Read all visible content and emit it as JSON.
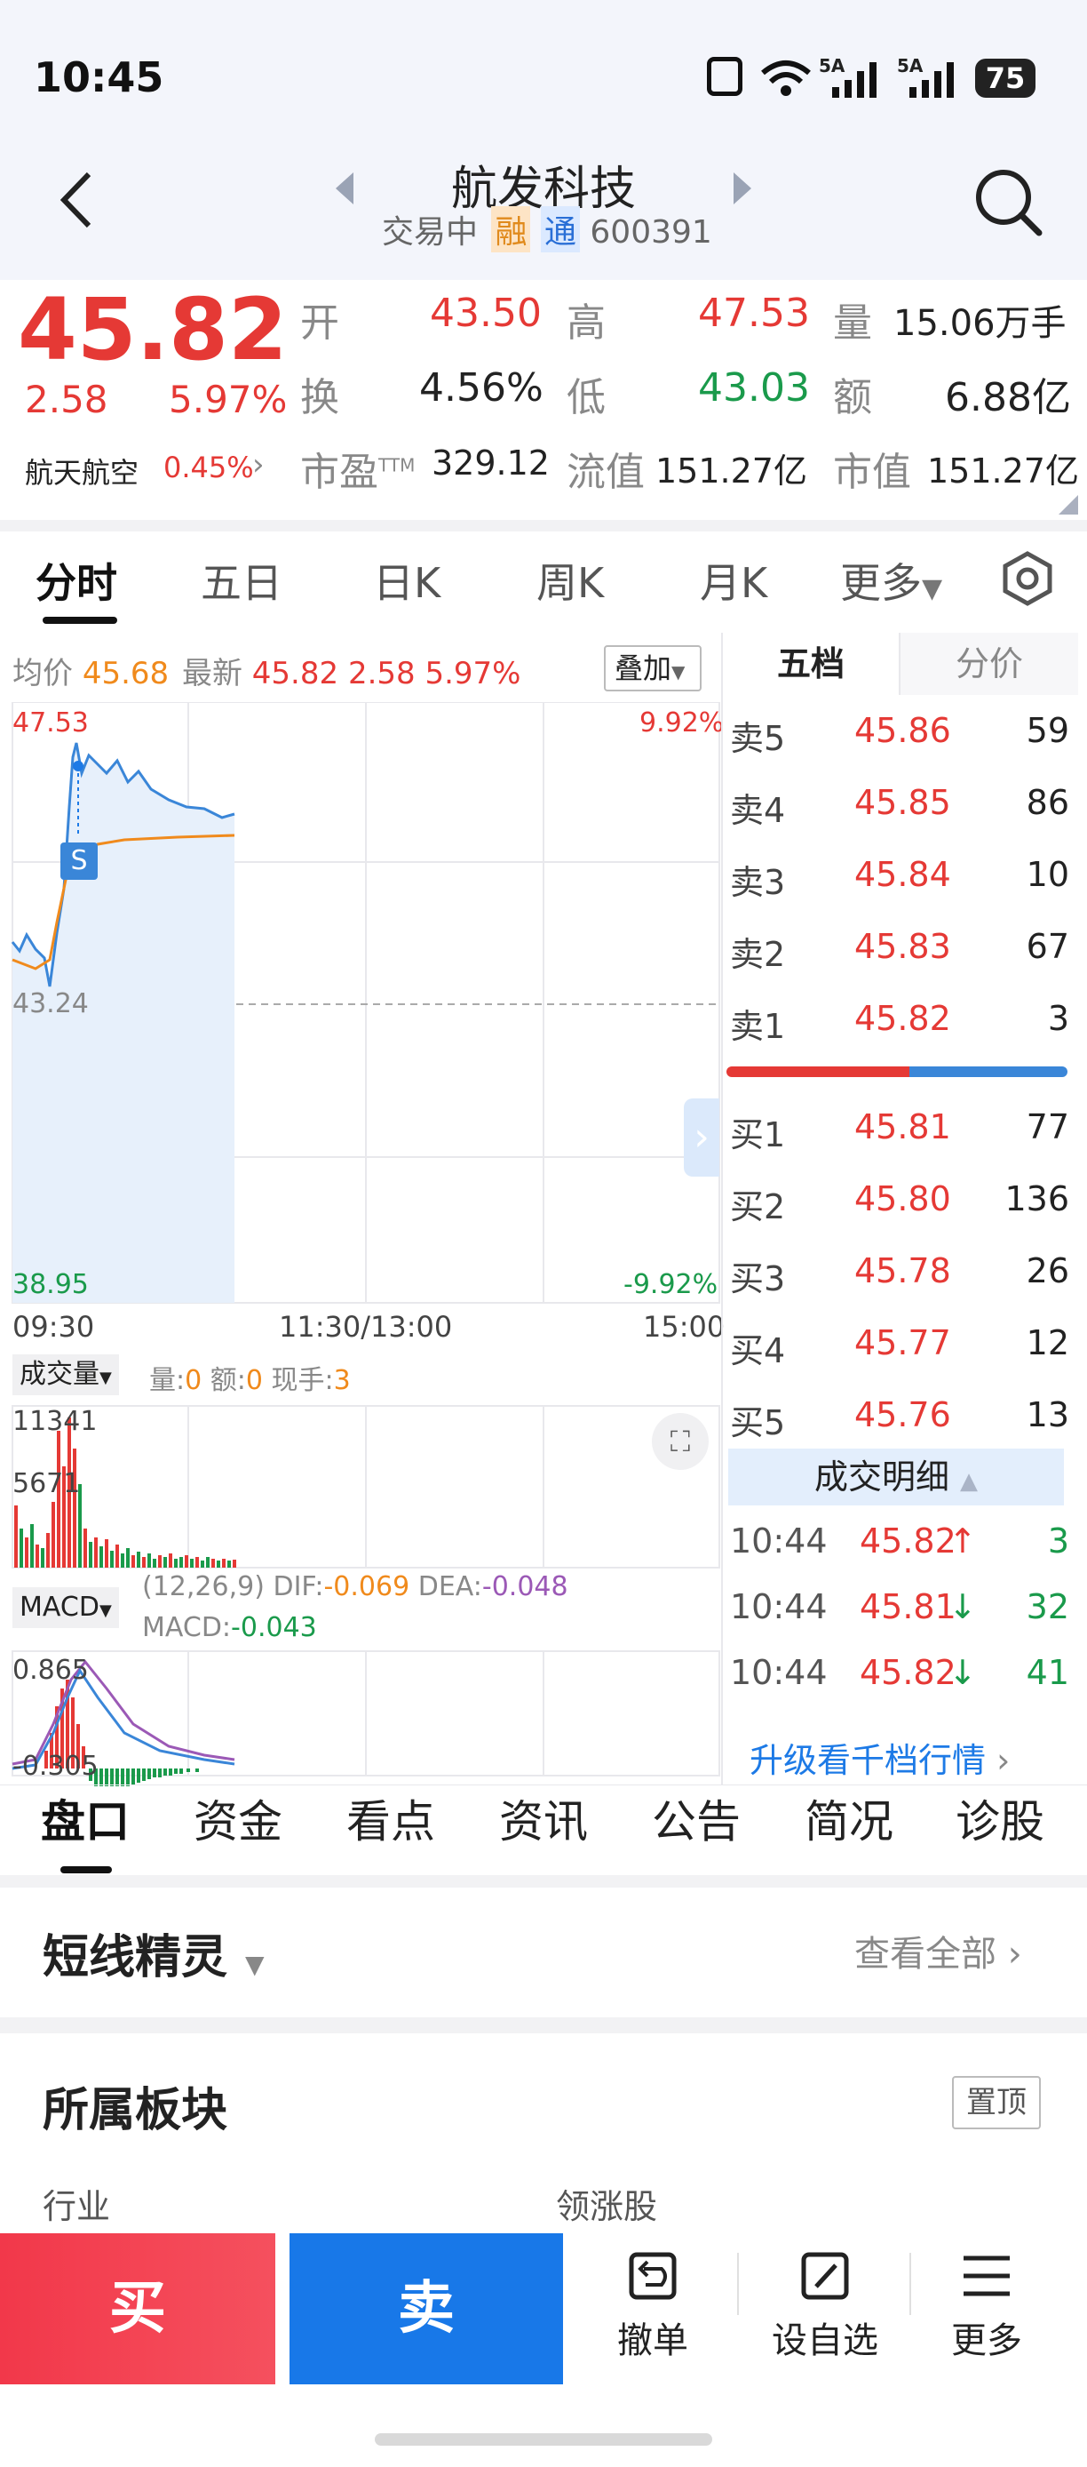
{
  "status": {
    "time": "10:45",
    "signal1": "5A",
    "signal2": "5A",
    "battery": "75"
  },
  "header": {
    "stock_name": "航发科技",
    "status": "交易中",
    "badge1": "融",
    "badge2": "通",
    "code": "600391"
  },
  "quote": {
    "price": "45.82",
    "change": "2.58",
    "change_pct": "5.97%",
    "sector": "航天航空",
    "sector_pct": "0.45%",
    "open_label": "开",
    "open": "43.50",
    "high_label": "高",
    "high": "47.53",
    "vol_label": "量",
    "vol": "15.06万手",
    "turnover_label": "换",
    "turnover": "4.56%",
    "low_label": "低",
    "low": "43.03",
    "amt_label": "额",
    "amt": "6.88亿",
    "pe_label": "市盈",
    "pe_sup": "TTM",
    "pe": "329.12",
    "float_label": "流值",
    "float_val": "151.27亿",
    "cap_label": "市值",
    "cap": "151.27亿"
  },
  "chart_tabs": [
    "分时",
    "五日",
    "日K",
    "周K",
    "月K",
    "更多"
  ],
  "intraday": {
    "avg_label": "均价",
    "avg": "45.68",
    "latest_label": "最新",
    "latest": "45.82",
    "chg": "2.58",
    "pct": "5.97%",
    "overlay": "叠加",
    "y_high": "47.53",
    "y_mid": "43.24",
    "y_low": "38.95",
    "pct_high": "9.92%",
    "pct_low": "-9.92%",
    "t_start": "09:30",
    "t_mid": "11:30/13:00",
    "t_end": "15:00",
    "marker": "S",
    "vol_label": "成交量",
    "vol_text": "量:",
    "vol_v": "0",
    "amt_text": "额:",
    "amt_v": "0",
    "hand_text": "现手:",
    "hand_v": "3",
    "vol_max": "11341",
    "vol_mid": "5671",
    "macd_label": "MACD",
    "macd_param": "(12,26,9)",
    "dif_label": "DIF:",
    "dif": "-0.069",
    "dea_label": "DEA:",
    "dea": "-0.048",
    "macd_text": "MACD:",
    "macd": "-0.043",
    "macd_max": "0.865",
    "macd_min": "-0.305"
  },
  "orderbook": {
    "tab1": "五档",
    "tab2": "分价",
    "asks": [
      {
        "label": "卖5",
        "price": "45.86",
        "vol": "59"
      },
      {
        "label": "卖4",
        "price": "45.85",
        "vol": "86"
      },
      {
        "label": "卖3",
        "price": "45.84",
        "vol": "10"
      },
      {
        "label": "卖2",
        "price": "45.83",
        "vol": "67"
      },
      {
        "label": "卖1",
        "price": "45.82",
        "vol": "3"
      }
    ],
    "bids": [
      {
        "label": "买1",
        "price": "45.81",
        "vol": "77"
      },
      {
        "label": "买2",
        "price": "45.80",
        "vol": "136"
      },
      {
        "label": "买3",
        "price": "45.78",
        "vol": "26"
      },
      {
        "label": "买4",
        "price": "45.77",
        "vol": "12"
      },
      {
        "label": "买5",
        "price": "45.76",
        "vol": "13"
      }
    ],
    "detail_label": "成交明细",
    "trades": [
      {
        "time": "10:44",
        "price": "45.82",
        "arrow": "↑",
        "vol": "3"
      },
      {
        "time": "10:44",
        "price": "45.81",
        "arrow": "↓",
        "vol": "32"
      },
      {
        "time": "10:44",
        "price": "45.82",
        "arrow": "↓",
        "vol": "41"
      }
    ],
    "upgrade": "升级看千档行情"
  },
  "bottom_tabs": [
    "盘口",
    "资金",
    "看点",
    "资讯",
    "公告",
    "简况",
    "诊股"
  ],
  "sprite": {
    "title": "短线精灵",
    "view_all": "查看全部"
  },
  "sector_block": {
    "title": "所属板块",
    "pin": "置顶",
    "col1": "行业",
    "col2": "领涨股"
  },
  "actions": {
    "buy": "买",
    "sell": "卖",
    "cancel": "撤单",
    "watch": "设自选",
    "more": "更多"
  },
  "colors": {
    "red": "#e53935",
    "green": "#1a9a4b",
    "blue": "#1d7ae6",
    "buy": "#f23d48",
    "sell": "#1878e8"
  }
}
